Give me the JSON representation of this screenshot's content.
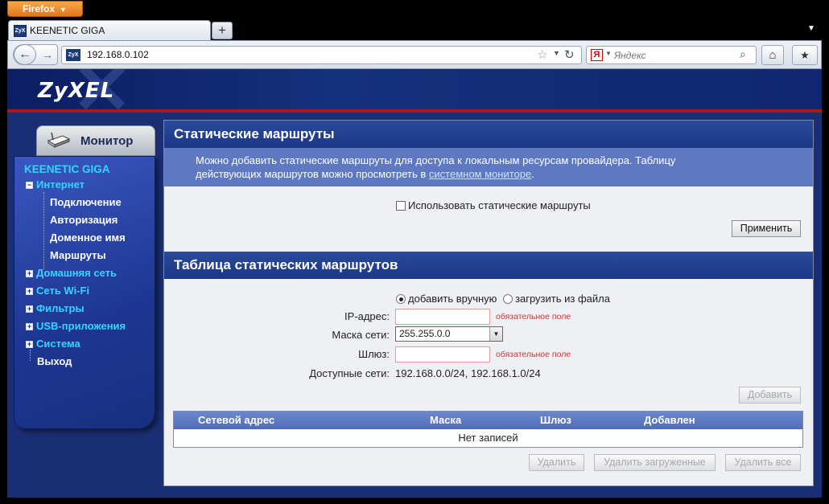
{
  "browser": {
    "menu_label": "Firefox",
    "tab_title": "KEENETIC GIGA",
    "favicon_text": "ZyX",
    "url": "192.168.0.102",
    "search_placeholder": "Яндекс",
    "search_engine_letter": "Я"
  },
  "brand": {
    "logo": "ZyXEL"
  },
  "monitor_tab": {
    "label": "Монитор"
  },
  "sidebar": {
    "title": "KEENETIC GIGA",
    "items": [
      {
        "label": "Интернет",
        "expanded": true
      },
      {
        "label": "Подключение"
      },
      {
        "label": "Авторизация"
      },
      {
        "label": "Доменное имя"
      },
      {
        "label": "Маршруты"
      },
      {
        "label": "Домашняя сеть"
      },
      {
        "label": "Сеть Wi-Fi"
      },
      {
        "label": "Фильтры"
      },
      {
        "label": "USB-приложения"
      },
      {
        "label": "Система"
      },
      {
        "label": "Выход"
      }
    ]
  },
  "static_routes": {
    "title": "Статические маршруты",
    "info_line1": "Можно добавить статические маршруты для доступа к локальным ресурсам провайдера. Таблицу",
    "info_line2_prefix": "действующих маршрутов можно просмотреть в ",
    "info_link": "системном мониторе",
    "info_suffix": ".",
    "checkbox_label": "Использовать статические маршруты",
    "apply_button": "Применить"
  },
  "route_table": {
    "title": "Таблица статических маршрутов",
    "radio_manual": "добавить вручную",
    "radio_file": "загрузить из файла",
    "ip_label": "IP-адрес:",
    "mask_label": "Маска сети:",
    "gateway_label": "Шлюз:",
    "required_hint": "обязательное поле",
    "mask_value": "255.255.0.0",
    "available_label": "Доступные сети:",
    "available_value": "192.168.0.0/24, 192.168.1.0/24",
    "add_button": "Добавить",
    "columns": [
      "Сетевой адрес",
      "Маска",
      "Шлюз",
      "Добавлен"
    ],
    "empty_text": "Нет записей",
    "delete_button": "Удалить",
    "delete_loaded_button": "Удалить загруженные",
    "delete_all_button": "Удалить все"
  },
  "icons": [
    "back-icon",
    "forward-icon",
    "star-icon",
    "reload-icon",
    "search-icon",
    "home-icon",
    "bookmarks-icon",
    "new-tab-icon",
    "router-icon"
  ]
}
